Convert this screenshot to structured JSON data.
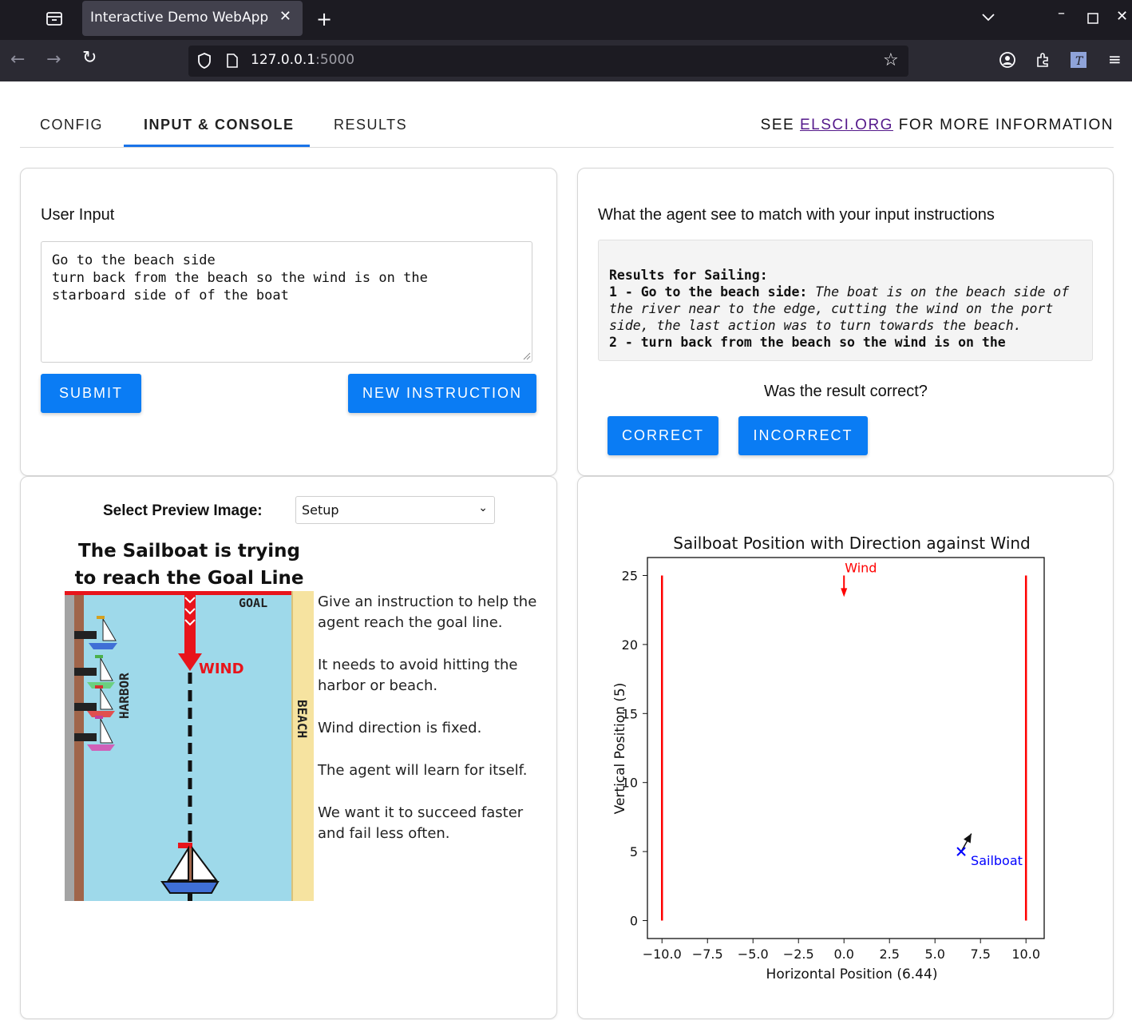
{
  "browser": {
    "tab_title": "Interactive Demo WebApp",
    "url_host": "127.0.0.1",
    "url_port": ":5000"
  },
  "app_tabs": [
    "CONFIG",
    "INPUT & CONSOLE",
    "RESULTS"
  ],
  "active_tab": "INPUT & CONSOLE",
  "header_info": {
    "prefix": "SEE ",
    "link": "ELSCI.ORG",
    "suffix": " FOR MORE INFORMATION"
  },
  "user_input": {
    "label": "User Input",
    "text": "Go to the beach side\nturn back from the beach so the wind is on the\nstarboard side of of the boat",
    "submit_label": "SUBMIT",
    "new_instruction_label": "NEW INSTRUCTION"
  },
  "agent_view": {
    "label": "What the agent see to match with your input instructions",
    "results_heading": "Results for Sailing:",
    "item1_title": "1 - Go to the beach side:",
    "item1_body": "The boat is on the beach side of the river near to the edge, cutting the wind on the port side, the last action was to turn towards the beach.",
    "item2_title": "2 - turn back from the beach so the wind is on the",
    "question": "Was the result correct?",
    "correct_label": "CORRECT",
    "incorrect_label": "INCORRECT"
  },
  "preview": {
    "select_label": "Select Preview Image:",
    "selected": "Setup",
    "image_title": "The Sailboat is trying to reach the Goal Line",
    "image_labels": {
      "goal": "GOAL",
      "wind": "WIND",
      "harbor": "HARBOR",
      "beach": "BEACH"
    },
    "description": [
      "Give an instruction to help the agent reach the goal line.",
      "It needs to avoid hitting the harbor or beach.",
      "Wind direction is fixed.",
      "The agent will learn for itself.",
      "We want it to succeed faster and fail less often."
    ]
  },
  "chart_data": {
    "type": "scatter",
    "title": "Sailboat Position with Direction against Wind",
    "xlabel": "Horizontal Position (6.44)",
    "ylabel": "Vertical Position (5)",
    "xlim": [
      -10.8,
      11.0
    ],
    "ylim": [
      -1.3,
      26.3
    ],
    "xticks": [
      -10.0,
      -7.5,
      -5.0,
      -2.5,
      0.0,
      2.5,
      5.0,
      7.5,
      10.0
    ],
    "xtick_labels": [
      "−10.0",
      "−7.5",
      "−5.0",
      "−2.5",
      "0.0",
      "2.5",
      "5.0",
      "7.5",
      "10.0"
    ],
    "yticks": [
      0,
      5,
      10,
      15,
      20,
      25
    ],
    "boundaries": [
      {
        "name": "left-boundary",
        "x": -10,
        "y_range": [
          0,
          25
        ],
        "color": "#ff0000"
      },
      {
        "name": "right-boundary",
        "x": 10,
        "y_range": [
          0,
          25
        ],
        "color": "#ff0000"
      }
    ],
    "wind": {
      "label": "Wind",
      "x": 0,
      "y_from": 25,
      "y_to": 23.5,
      "color": "#ff0000"
    },
    "sailboat": {
      "label": "Sailboat",
      "x": 6.44,
      "y": 5,
      "heading_to": [
        7.0,
        6.3
      ],
      "color": "#0000ff"
    }
  }
}
